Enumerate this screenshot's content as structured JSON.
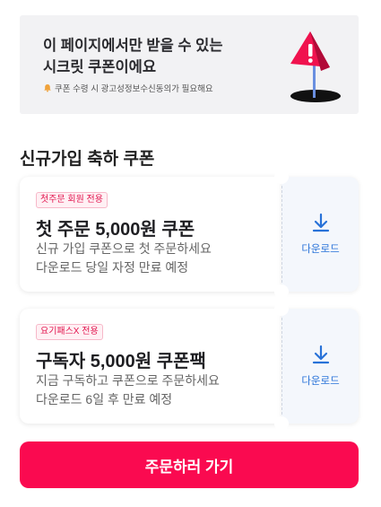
{
  "banner": {
    "title_line1": "이 페이지에서만 받을 수 있는",
    "title_line2": "시크릿 쿠폰이에요",
    "note": "쿠폰 수령 시 광고성정보수신동의가 필요해요",
    "icon": "alert-flag-in-hole-icon"
  },
  "section": {
    "title": "신규가입 축하 쿠폰"
  },
  "coupons": [
    {
      "badge": "첫주문 회원 전용",
      "name": "첫 주문 5,000원 쿠폰",
      "desc_line1": "신규 가입 쿠폰으로 첫 주문하세요",
      "desc_line2": "다운로드 당일 자정 만료 예정",
      "download_label": "다운로드"
    },
    {
      "badge": "요기패스X 전용",
      "name": "구독자 5,000원 쿠폰팩",
      "desc_line1": "지금 구독하고 쿠폰으로 주문하세요",
      "desc_line2": "다운로드 6일 후 만료 예정",
      "download_label": "다운로드"
    }
  ],
  "cta": {
    "label": "주문하러 가기"
  },
  "colors": {
    "accent": "#fa0a50",
    "download_blue": "#2872d8",
    "badge_pink": "#e2154e"
  }
}
